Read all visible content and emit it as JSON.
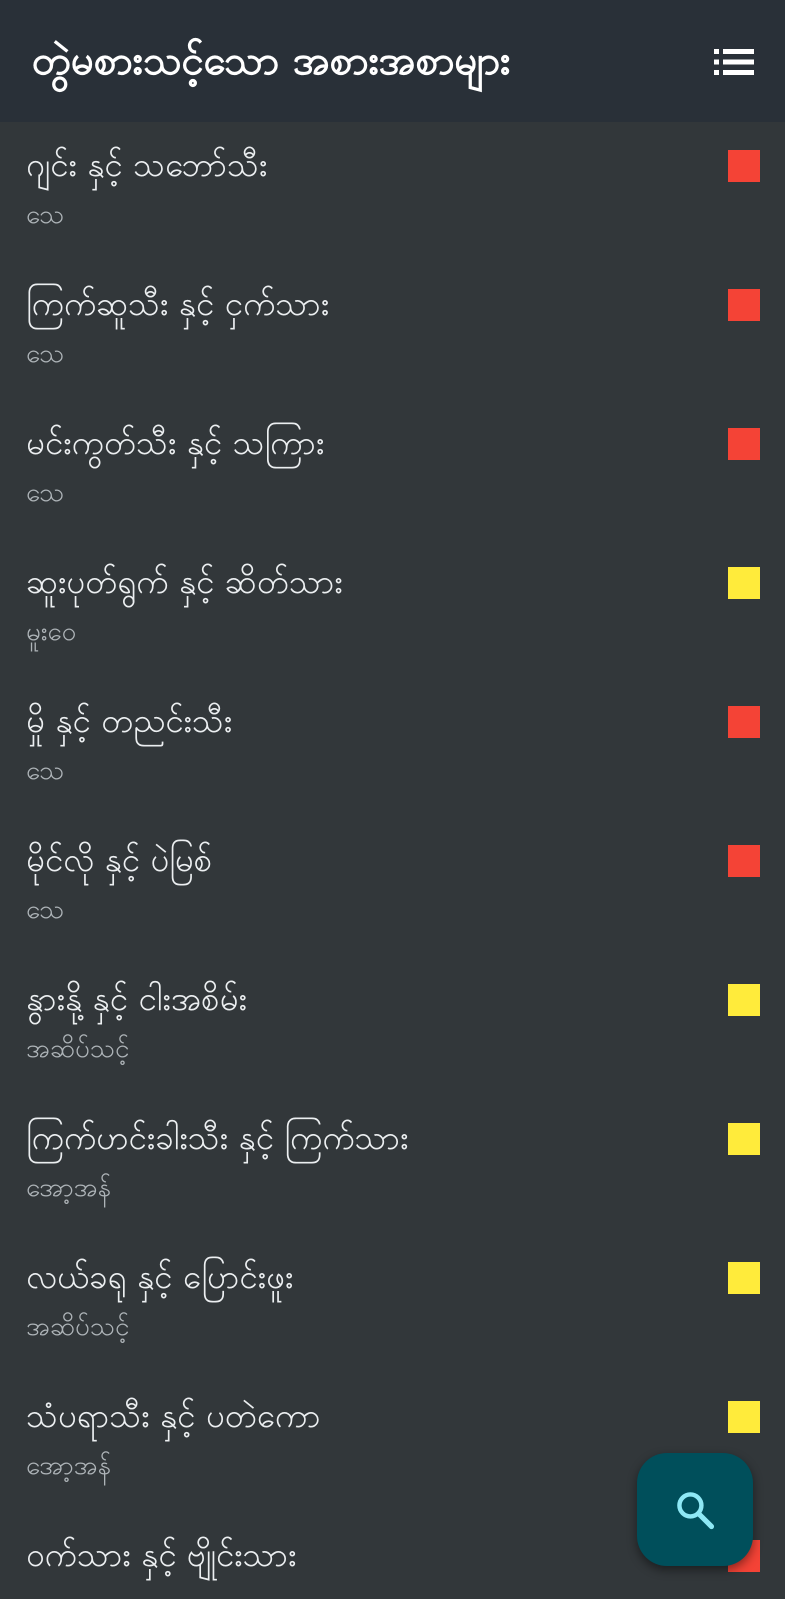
{
  "app_bar": {
    "title": "တွဲမစားသင့်သော အစားအစာများ",
    "menu_icon": "list-icon"
  },
  "colors": {
    "red": "#f44336",
    "yellow": "#ffeb3b",
    "header_bg": "#293038",
    "list_bg": "#32373a",
    "fab_bg": "#004f5b",
    "fab_icon": "#8ee8f5"
  },
  "items": [
    {
      "title": "ဂျင်း နှင့် သဘော်သီး",
      "subtitle": "သေ",
      "level": "red"
    },
    {
      "title": "ကြက်ဆူသီး နှင့် ငှက်သား",
      "subtitle": "သေ",
      "level": "red"
    },
    {
      "title": "မင်းကွတ်သီး နှင့် သကြား",
      "subtitle": "သေ",
      "level": "red"
    },
    {
      "title": "ဆူးပုတ်ရွက် နှင့် ဆိတ်သား",
      "subtitle": "မူးဝေ",
      "level": "yellow"
    },
    {
      "title": "မှို နှင့် တညင်းသီး",
      "subtitle": "သေ",
      "level": "red"
    },
    {
      "title": "မိုင်လို နှင့် ပဲမြစ်",
      "subtitle": "သေ",
      "level": "red"
    },
    {
      "title": "နွားနို့ နှင့် ငါးအစိမ်း",
      "subtitle": "အဆိပ်သင့်",
      "level": "yellow"
    },
    {
      "title": "ကြက်ဟင်းခါးသီး နှင့် ကြက်သား",
      "subtitle": "အော့အန်",
      "level": "yellow"
    },
    {
      "title": "လယ်ခရု နှင့် ပြောင်းဖူး",
      "subtitle": "အဆိပ်သင့်",
      "level": "yellow"
    },
    {
      "title": "သံပရာသီး နှင့် ပတဲကော",
      "subtitle": "အော့အန်",
      "level": "yellow"
    },
    {
      "title": "ဝက်သား နှင့် ဗျိုင်းသား",
      "subtitle": "",
      "level": "red"
    }
  ],
  "fab": {
    "icon": "search-icon"
  }
}
